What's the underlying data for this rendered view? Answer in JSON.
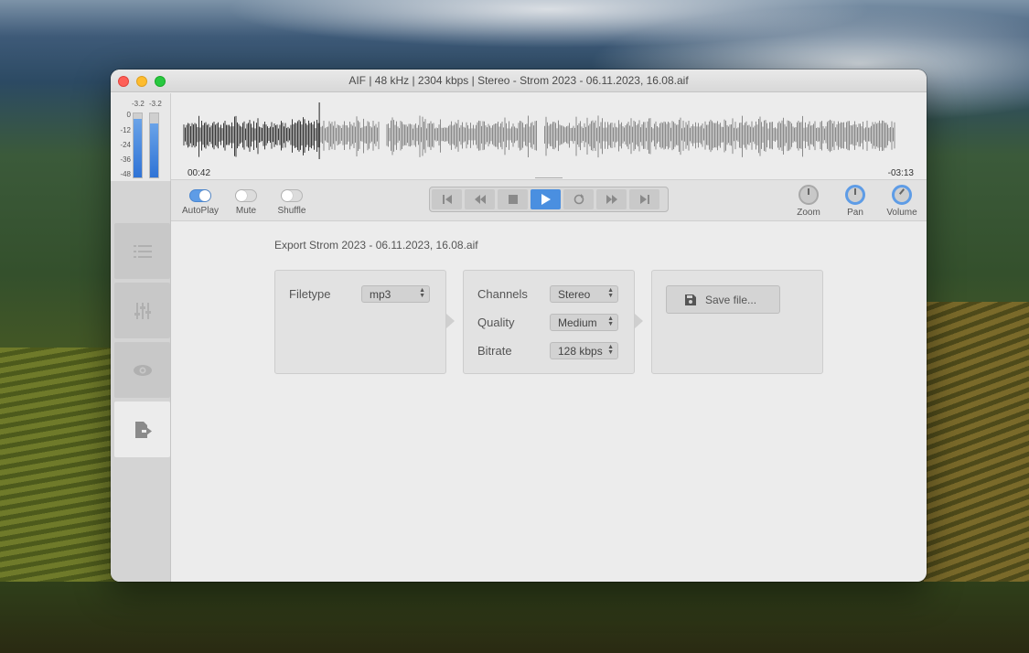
{
  "window": {
    "title": "AIF | 48 kHz | 2304 kbps | Stereo - Strom 2023 - 06.11.2023, 16.08.aif"
  },
  "meters": {
    "peak_left": "-3.2",
    "peak_right": "-3.2",
    "scale": [
      "0",
      "-12",
      "-24",
      "-36",
      "-48"
    ],
    "left_level": 0.92,
    "right_level": 0.85,
    "color": "#2f73d6"
  },
  "waveform": {
    "elapsed": "00:42",
    "remaining": "-03:13",
    "played_fraction": 0.19
  },
  "toggles": [
    {
      "label": "AutoPlay",
      "on": true
    },
    {
      "label": "Mute",
      "on": false
    },
    {
      "label": "Shuffle",
      "on": false
    }
  ],
  "transport": {
    "icons": [
      "skip-back-icon",
      "rewind-icon",
      "stop-icon",
      "play-icon",
      "repeat-icon",
      "fast-forward-icon",
      "skip-forward-icon"
    ],
    "accent": "#4a8fe0"
  },
  "knobs": [
    {
      "label": "Zoom"
    },
    {
      "label": "Pan"
    },
    {
      "label": "Volume"
    }
  ],
  "sidebar": {
    "items": [
      "list-icon",
      "sliders-icon",
      "eye-icon",
      "export-icon"
    ],
    "active_index": 3
  },
  "export": {
    "title": "Export Strom 2023 - 06.11.2023, 16.08.aif",
    "filetype_label": "Filetype",
    "filetype_value": "mp3",
    "channels_label": "Channels",
    "channels_value": "Stereo",
    "quality_label": "Quality",
    "quality_value": "Medium",
    "bitrate_label": "Bitrate",
    "bitrate_value": "128 kbps",
    "save_label": "Save file..."
  }
}
